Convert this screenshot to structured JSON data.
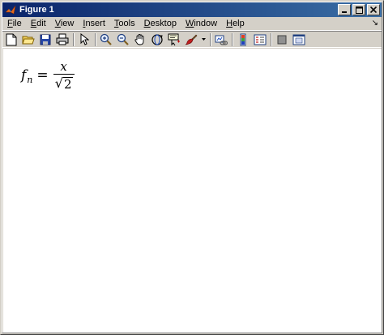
{
  "window": {
    "title": "Figure 1",
    "minimize_label": "_",
    "maximize_label": "□",
    "close_label": "✕"
  },
  "menu": {
    "items": [
      {
        "label": "File",
        "key": "F",
        "rest": "ile"
      },
      {
        "label": "Edit",
        "key": "E",
        "rest": "dit"
      },
      {
        "label": "View",
        "key": "V",
        "rest": "iew"
      },
      {
        "label": "Insert",
        "key": "I",
        "rest": "nsert"
      },
      {
        "label": "Tools",
        "key": "T",
        "rest": "ools"
      },
      {
        "label": "Desktop",
        "key": "D",
        "rest": "esktop"
      },
      {
        "label": "Window",
        "key": "W",
        "rest": "indow"
      },
      {
        "label": "Help",
        "key": "H",
        "rest": "elp"
      }
    ],
    "dock_glyph": "↘"
  },
  "toolbar": {
    "icons": [
      "new-figure-icon",
      "open-file-icon",
      "save-icon",
      "print-icon",
      "edit-plot-arrow-icon",
      "zoom-in-icon",
      "zoom-out-icon",
      "pan-hand-icon",
      "rotate-3d-icon",
      "data-cursor-icon",
      "brush-icon",
      "link-plot-icon",
      "colorbar-icon",
      "legend-icon",
      "hide-plot-tools-icon",
      "show-plot-tools-icon"
    ]
  },
  "formula": {
    "lhs_var": "f",
    "lhs_sub": "n",
    "equals": "=",
    "numerator": "x",
    "sqrt_glyph": "√",
    "radicand": "2"
  },
  "colors": {
    "titlebar_start": "#0a246a",
    "titlebar_end": "#3a6ea5",
    "chrome": "#d4d0c8",
    "canvas": "#ffffff"
  }
}
